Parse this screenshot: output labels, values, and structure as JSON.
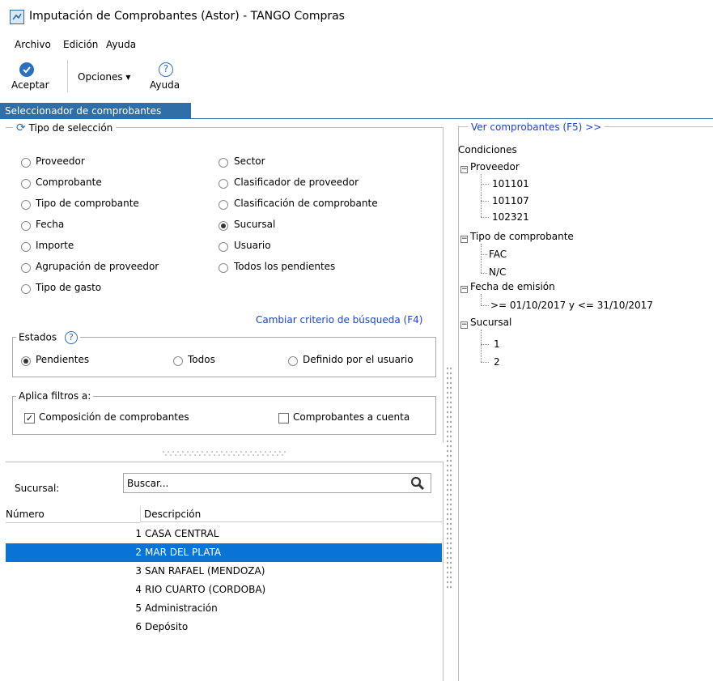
{
  "window": {
    "title": "Imputación de Comprobantes (Astor) - TANGO Compras"
  },
  "menu": {
    "items": [
      "Archivo",
      "Edición",
      "Ayuda"
    ]
  },
  "toolbar": {
    "accept_label": "Aceptar",
    "options_label": "Opciones ▾",
    "help_label": "Ayuda"
  },
  "tab": {
    "label": "Seleccionador de comprobantes"
  },
  "selection": {
    "legend": "Tipo de selección",
    "options_left": [
      "Proveedor",
      "Comprobante",
      "Tipo de comprobante",
      "Fecha",
      "Importe",
      "Agrupación de proveedor",
      "Tipo de gasto"
    ],
    "options_right": [
      "Sector",
      "Clasificador de proveedor",
      "Clasificación de comprobante",
      "Sucursal",
      "Usuario",
      "Todos los pendientes"
    ],
    "selected": "Sucursal",
    "change_criteria": "Cambiar criterio de búsqueda (F4)"
  },
  "estados": {
    "legend": "Estados",
    "options": [
      "Pendientes",
      "Todos",
      "Definido por el usuario"
    ],
    "selected": "Pendientes"
  },
  "filtros": {
    "legend": "Aplica filtros a:",
    "composicion": {
      "label": "Composición de comprobantes",
      "checked": true
    },
    "a_cuenta": {
      "label": "Comprobantes a cuenta",
      "checked": false
    }
  },
  "sucursal": {
    "label": "Sucursal:",
    "search_value": "Buscar...",
    "columns": [
      "Número",
      "Descripción"
    ],
    "rows": [
      {
        "numero": "1",
        "descripcion": "CASA CENTRAL"
      },
      {
        "numero": "2",
        "descripcion": "MAR DEL PLATA"
      },
      {
        "numero": "3",
        "descripcion": "SAN RAFAEL (MENDOZA)"
      },
      {
        "numero": "4",
        "descripcion": "RIO CUARTO (CORDOBA)"
      },
      {
        "numero": "5",
        "descripcion": "Administración"
      },
      {
        "numero": "6",
        "descripcion": "Depósito"
      }
    ],
    "selected_row": "2"
  },
  "conditions": {
    "link": "Ver comprobantes (F5) >>",
    "title": "Condiciones",
    "proveedor": {
      "label": "Proveedor",
      "items": [
        "101101",
        "101107",
        "102321"
      ]
    },
    "tipo": {
      "label": "Tipo de comprobante",
      "items": [
        "FAC",
        "N/C"
      ]
    },
    "fecha": {
      "label": "Fecha de emisión",
      "items": [
        ">= 01/10/2017 y <= 31/10/2017"
      ]
    },
    "sucursal": {
      "label": "Sucursal",
      "items": [
        "1",
        "2"
      ]
    }
  },
  "colors": {
    "accent": "#2f6ea7",
    "selection": "#0a73d6",
    "link": "#1c43c8"
  }
}
